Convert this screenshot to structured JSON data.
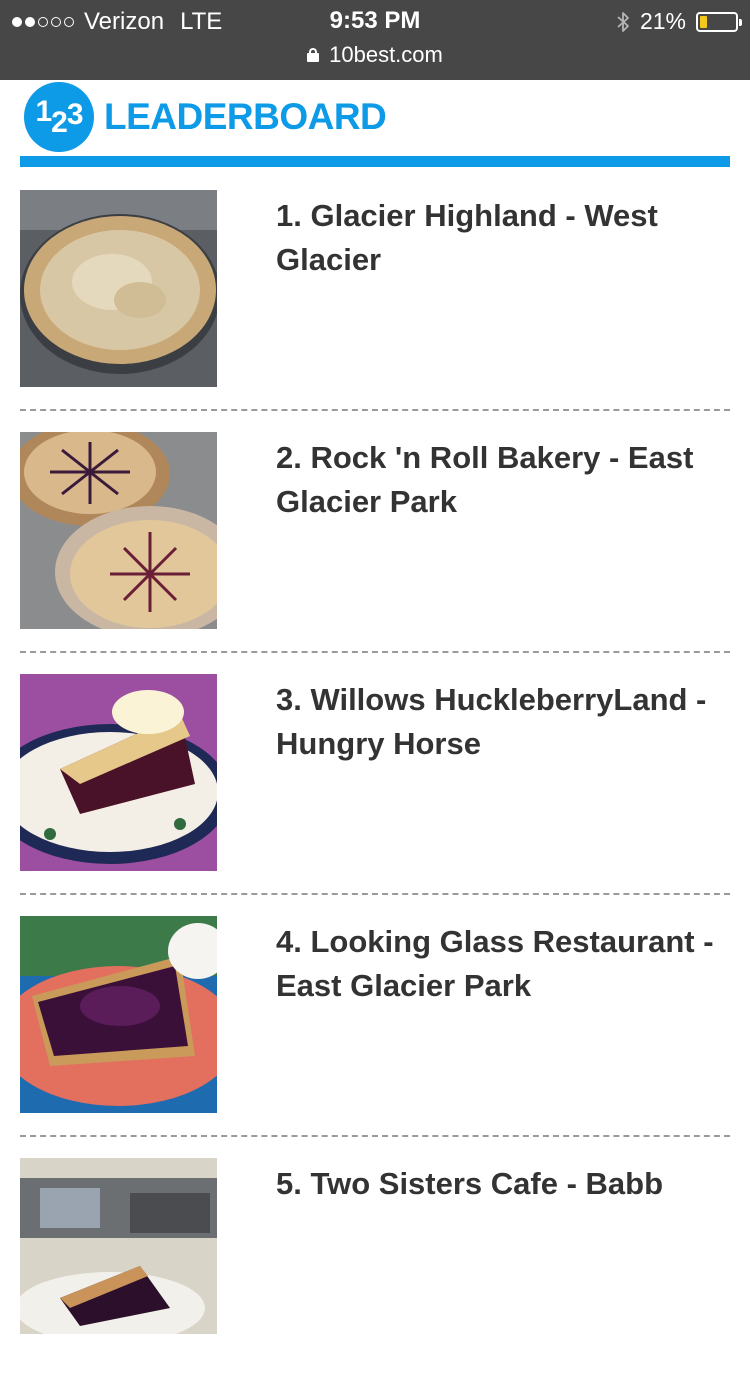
{
  "status_bar": {
    "carrier": "Verizon",
    "network": "LTE",
    "time": "9:53 PM",
    "battery_percent_label": "21%",
    "battery_level": 0.21,
    "signal_bars_filled": 2,
    "signal_bars_total": 5
  },
  "browser": {
    "url": "10best.com"
  },
  "leaderboard": {
    "badge_digits": [
      "1",
      "2",
      "3"
    ],
    "title": "LEADERBOARD",
    "accent_color": "#0d9ae6",
    "items": [
      {
        "name": "1. Glacier Highland - West Glacier",
        "thumb_icon": "crumb-crust-pie-photo"
      },
      {
        "name": "2. Rock 'n Roll Bakery - East Glacier Park",
        "thumb_icon": "lattice-pies-photo"
      },
      {
        "name": "3. Willows HuckleberryLand - Hungry Horse",
        "thumb_icon": "pie-slice-ice-cream-photo"
      },
      {
        "name": "4. Looking Glass Restaurant - East Glacier Park",
        "thumb_icon": "berry-pie-slice-cream-photo"
      },
      {
        "name": "5. Two Sisters Cafe - Babb",
        "thumb_icon": "pie-slice-cafe-photo"
      }
    ]
  }
}
